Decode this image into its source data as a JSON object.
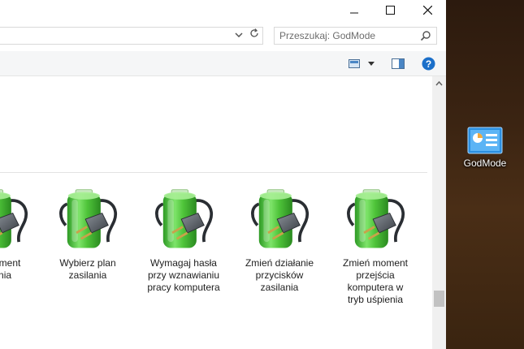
{
  "window": {
    "controls": {
      "minimize_icon": "minimize-icon",
      "maximize_icon": "maximize-icon",
      "close_icon": "close-icon"
    }
  },
  "address": {
    "value": ""
  },
  "search": {
    "placeholder": "Przeszukaj: GodMode",
    "value": ""
  },
  "items": [
    {
      "label": "moment\npienia\nu",
      "icon": "power-options-icon"
    },
    {
      "label": "Wybierz plan\nzasilania",
      "icon": "power-options-icon"
    },
    {
      "label": "Wymagaj hasła\nprzy wznawianiu\npracy komputera",
      "icon": "power-options-icon"
    },
    {
      "label": "Zmień działanie\nprzycisków\nzasilania",
      "icon": "power-options-icon"
    },
    {
      "label": "Zmień moment\nprzejścia\nkomputera w\ntryb uśpienia",
      "icon": "power-options-icon"
    }
  ],
  "desktop": {
    "icon_label": "GodMode",
    "icon": "control-panel-icon"
  },
  "colors": {
    "battery_green": "#4fc43a",
    "plug_gray": "#555b63",
    "desktop_bg": "#3b2412",
    "help_blue": "#1b6fc9"
  }
}
